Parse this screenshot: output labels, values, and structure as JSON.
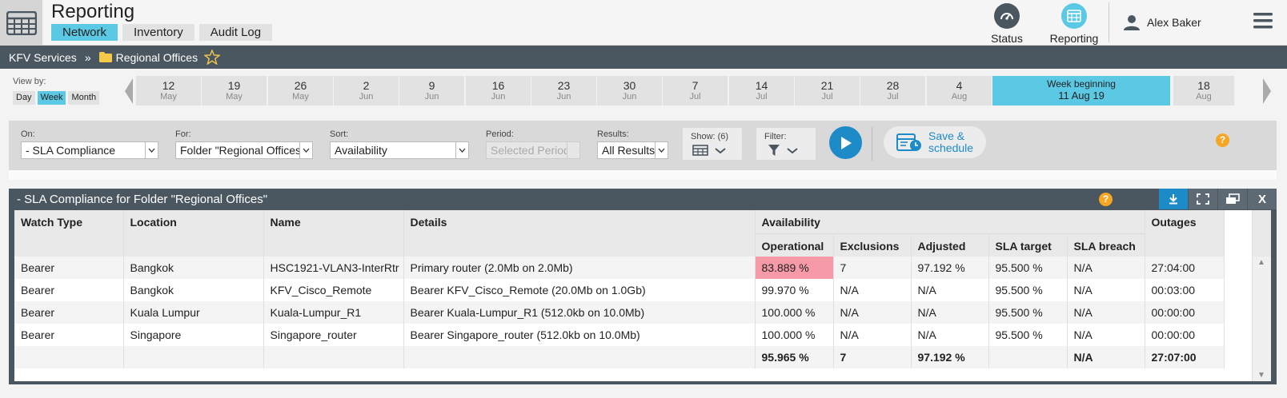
{
  "app": {
    "title": "Reporting",
    "tabs": [
      {
        "label": "Network",
        "active": true
      },
      {
        "label": "Inventory",
        "active": false
      },
      {
        "label": "Audit Log",
        "active": false
      }
    ],
    "status_label": "Status",
    "reporting_label": "Reporting",
    "user_name": "Alex Baker"
  },
  "breadcrumb": {
    "root": "KFV Services",
    "separator": "»",
    "current": "Regional Offices"
  },
  "timeline": {
    "view_by_label": "View by:",
    "views": [
      {
        "label": "Day",
        "active": false
      },
      {
        "label": "Week",
        "active": true
      },
      {
        "label": "Month",
        "active": false
      }
    ],
    "weeks": [
      {
        "day": "12",
        "month": "May"
      },
      {
        "day": "19",
        "month": "May"
      },
      {
        "day": "26",
        "month": "May"
      },
      {
        "day": "2",
        "month": "Jun"
      },
      {
        "day": "9",
        "month": "Jun"
      },
      {
        "day": "16",
        "month": "Jun"
      },
      {
        "day": "23",
        "month": "Jun"
      },
      {
        "day": "30",
        "month": "Jun"
      },
      {
        "day": "7",
        "month": "Jul"
      },
      {
        "day": "14",
        "month": "Jul"
      },
      {
        "day": "21",
        "month": "Jul"
      },
      {
        "day": "28",
        "month": "Jul"
      },
      {
        "day": "4",
        "month": "Aug"
      }
    ],
    "current": {
      "title": "Week beginning",
      "date": "11 Aug 19"
    },
    "after": {
      "day": "18",
      "month": "Aug"
    }
  },
  "filters": {
    "on_label": "On:",
    "on_value": "- SLA Compliance",
    "for_label": "For:",
    "for_value": "Folder \"Regional Offices\"",
    "sort_label": "Sort:",
    "sort_value": "Availability",
    "period_label": "Period:",
    "period_value": "Selected Period",
    "results_label": "Results:",
    "results_value": "All Results",
    "show_label": "Show: (6)",
    "filter_label": "Filter:",
    "save_line1": "Save &",
    "save_line2": "schedule"
  },
  "report": {
    "title": "- SLA Compliance for Folder \"Regional Offices\"",
    "close_label": "X",
    "columns": {
      "watch_type": "Watch Type",
      "location": "Location",
      "name": "Name",
      "details": "Details",
      "availability": "Availability",
      "operational": "Operational",
      "exclusions": "Exclusions",
      "adjusted": "Adjusted",
      "sla_target": "SLA target",
      "sla_breach": "SLA breach",
      "outages": "Outages"
    },
    "rows": [
      {
        "watch_type": "Bearer",
        "location": "Bangkok",
        "name": "HSC1921-VLAN3-InterRtr",
        "details": "Primary router (2.0Mb on 2.0Mb)",
        "operational": "83.889 %",
        "exclusions": "7",
        "adjusted": "97.192 %",
        "sla_target": "95.500 %",
        "sla_breach": "N/A",
        "outages": "27:04:00"
      },
      {
        "watch_type": "Bearer",
        "location": "Bangkok",
        "name": "KFV_Cisco_Remote",
        "details": "Bearer KFV_Cisco_Remote (20.0Mb on 1.0Gb)",
        "operational": "99.970 %",
        "exclusions": "N/A",
        "adjusted": "N/A",
        "sla_target": "95.500 %",
        "sla_breach": "N/A",
        "outages": "00:03:00"
      },
      {
        "watch_type": "Bearer",
        "location": "Kuala Lumpur",
        "name": "Kuala-Lumpur_R1",
        "details": "Bearer Kuala-Lumpur_R1 (512.0kb on 10.0Mb)",
        "operational": "100.000 %",
        "exclusions": "N/A",
        "adjusted": "N/A",
        "sla_target": "95.500 %",
        "sla_breach": "N/A",
        "outages": "00:00:00"
      },
      {
        "watch_type": "Bearer",
        "location": "Singapore",
        "name": "Singapore_router",
        "details": "Bearer Singapore_router (512.0kb on 10.0Mb)",
        "operational": "100.000 %",
        "exclusions": "N/A",
        "adjusted": "N/A",
        "sla_target": "95.500 %",
        "sla_breach": "N/A",
        "outages": "00:00:00"
      }
    ],
    "totals": {
      "operational": "95.965 %",
      "exclusions": "7",
      "adjusted": "97.192 %",
      "sla_breach": "N/A",
      "outages": "27:07:00"
    }
  },
  "colors": {
    "accent": "#5bc8e4",
    "header_bar": "#4a5761",
    "run_button": "#1d8bc8",
    "breach_highlight": "#f59aa6",
    "help": "#f5a623"
  }
}
